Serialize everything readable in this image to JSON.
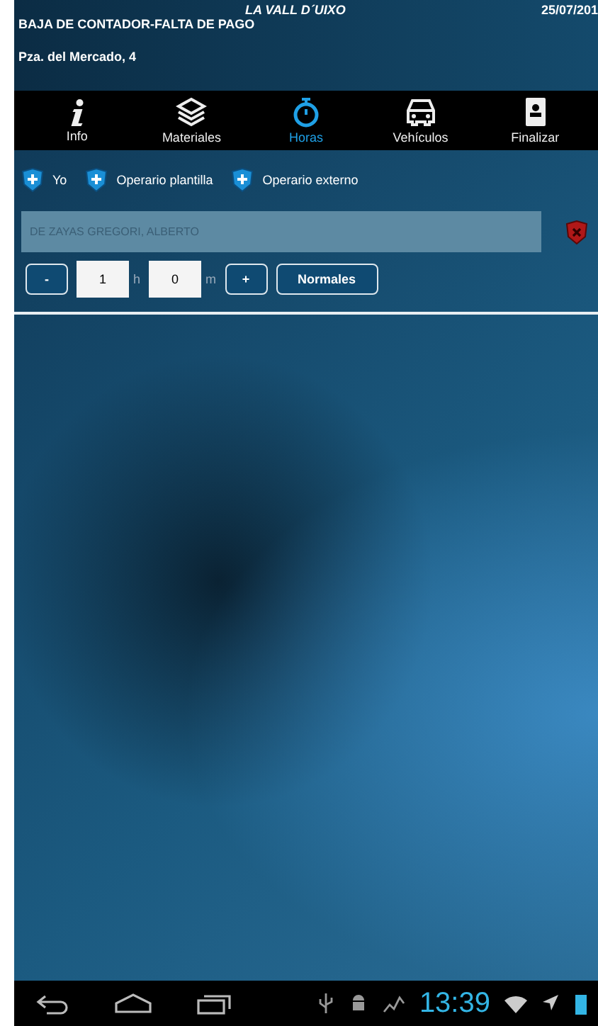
{
  "header": {
    "town": "LA VALL D´UIXO",
    "date": "25/07/201",
    "job": "BAJA DE CONTADOR-FALTA DE PAGO",
    "address": "Pza. del Mercado, 4"
  },
  "tabs": [
    {
      "label": "Info",
      "kind": "info",
      "selected": false
    },
    {
      "label": "Materiales",
      "kind": "layers",
      "selected": false
    },
    {
      "label": "Horas",
      "kind": "stopwatch",
      "selected": true
    },
    {
      "label": "Vehículos",
      "kind": "car",
      "selected": false
    },
    {
      "label": "Finalizar",
      "kind": "contacts",
      "selected": false
    }
  ],
  "add_buttons": [
    "Yo",
    "Operario plantilla",
    "Operario externo"
  ],
  "worker": {
    "name": "DE ZAYAS GREGORI, ALBERTO"
  },
  "time": {
    "minus": "-",
    "hours": "1",
    "hours_unit": "h",
    "minutes": "0",
    "minutes_unit": "m",
    "plus": "+",
    "type": "Normales"
  },
  "status_bar": {
    "time": "13:39"
  }
}
